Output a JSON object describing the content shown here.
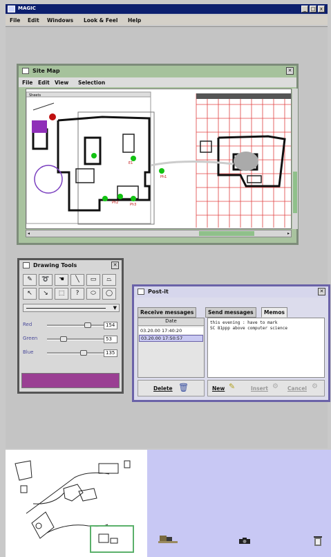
{
  "app": {
    "title": "MAGIC",
    "controls": [
      "_",
      "□",
      "x"
    ]
  },
  "menubar": [
    "File",
    "Edit",
    "Windows",
    "Look & Feel",
    "Help"
  ],
  "sitemap": {
    "title": "Site Map",
    "menu": [
      "File",
      "Edit",
      "View",
      "Selection"
    ],
    "inner_frame_title": "Sheets",
    "labels": [
      "E1",
      "Ph1",
      "Ph2",
      "Ph3"
    ]
  },
  "drawing_tools": {
    "title": "Drawing Tools",
    "tools": [
      {
        "icon": "pencil-icon",
        "glyph": "✎"
      },
      {
        "icon": "lasso-icon",
        "glyph": "➰"
      },
      {
        "icon": "hand-icon",
        "glyph": "☚"
      },
      {
        "icon": "line-icon",
        "glyph": "╲"
      },
      {
        "icon": "rectangle-icon",
        "glyph": "▭"
      },
      {
        "icon": "polygon-icon",
        "glyph": "⏢"
      },
      {
        "icon": "arrow-pointer-icon",
        "glyph": "↖"
      },
      {
        "icon": "arrow-line-icon",
        "glyph": "↘"
      },
      {
        "icon": "dotted-rectangle-icon",
        "glyph": "⬚"
      },
      {
        "icon": "question-icon",
        "glyph": "?"
      },
      {
        "icon": "ellipse-icon",
        "glyph": "⬭"
      },
      {
        "icon": "circle-icon",
        "glyph": "◯"
      }
    ],
    "sliders": [
      {
        "label": "Red",
        "value": "154",
        "fraction": 0.6
      },
      {
        "label": "Green",
        "value": "53",
        "fraction": 0.21
      },
      {
        "label": "Blue",
        "value": "135",
        "fraction": 0.53
      }
    ],
    "preview_color": "#9a3f93"
  },
  "postit": {
    "title": "Post-it",
    "tabs": [
      "Receive messages",
      "Send messages",
      "Memos"
    ],
    "active_tab": "Memos",
    "column_header": "Date",
    "dates": [
      "03.20.00 17:40:20",
      "03.20.00 17:50:57"
    ],
    "memo_text": "this evening : have to mark\nSC 81ppp above computer science",
    "buttons": {
      "delete": "Delete",
      "new": "New",
      "insert": "Insert",
      "cancel": "Cancel"
    }
  },
  "colors": {
    "titlebar": "#0c1f6e",
    "sitemap_frame": "#a9c39f",
    "postit_frame": "#6a62a8",
    "tray": "#c8c8f4",
    "grid": "#e04040"
  }
}
